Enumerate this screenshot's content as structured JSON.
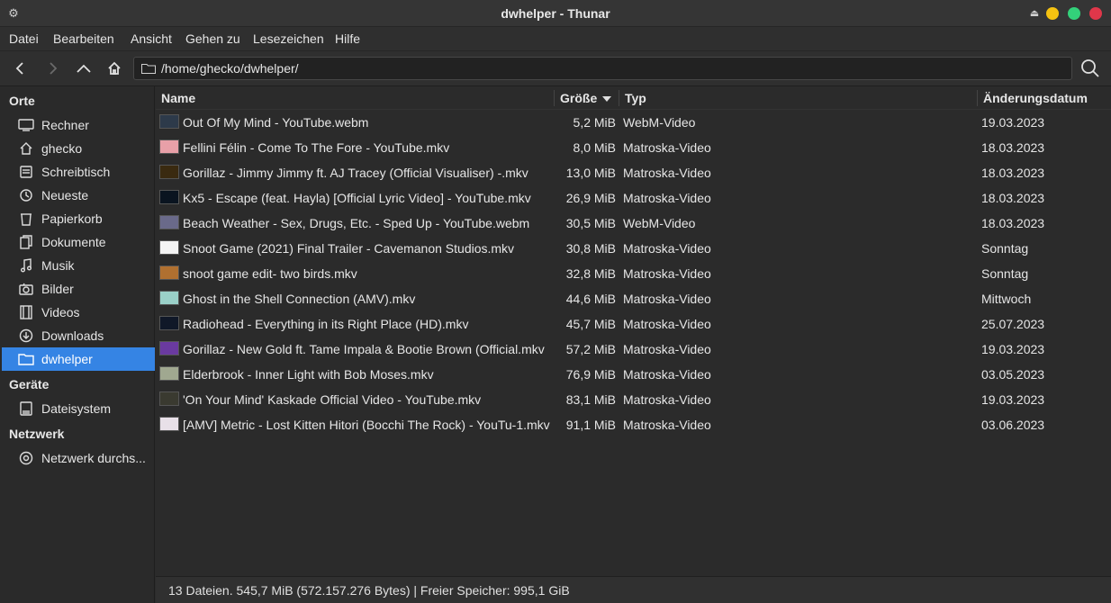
{
  "window": {
    "title": "dwhelper - Thunar"
  },
  "menubar": {
    "items": [
      {
        "label": "Datei"
      },
      {
        "label": "Bearbeiten"
      },
      {
        "label": "Ansicht"
      },
      {
        "label": "Gehen zu"
      },
      {
        "label": "Lesezeichen"
      },
      {
        "label": "Hilfe"
      }
    ]
  },
  "toolbar": {
    "location": "/home/ghecko/dwhelper/"
  },
  "sidebar": {
    "headings": {
      "places": "Orte",
      "devices": "Geräte",
      "network": "Netzwerk"
    },
    "places": [
      {
        "label": "Rechner",
        "icon": "computer-icon"
      },
      {
        "label": "ghecko",
        "icon": "home-icon"
      },
      {
        "label": "Schreibtisch",
        "icon": "desktop-icon"
      },
      {
        "label": "Neueste",
        "icon": "recent-icon"
      },
      {
        "label": "Papierkorb",
        "icon": "trash-icon"
      },
      {
        "label": "Dokumente",
        "icon": "documents-icon"
      },
      {
        "label": "Musik",
        "icon": "music-icon"
      },
      {
        "label": "Bilder",
        "icon": "camera-icon"
      },
      {
        "label": "Videos",
        "icon": "film-icon"
      },
      {
        "label": "Downloads",
        "icon": "download-icon"
      },
      {
        "label": "dwhelper",
        "icon": "folder-icon",
        "active": true
      }
    ],
    "devices": [
      {
        "label": "Dateisystem",
        "icon": "drive-icon"
      }
    ],
    "network": [
      {
        "label": "Netzwerk durchs...",
        "icon": "network-icon"
      }
    ]
  },
  "filelist": {
    "columns": {
      "name": "Name",
      "size": "Größe",
      "type": "Typ",
      "date": "Änderungsdatum"
    },
    "sort": {
      "column": "size",
      "direction": "descending-arrow"
    },
    "files": [
      {
        "name": "Out Of My Mind - YouTube.webm",
        "size": "5,2 MiB",
        "type": "WebM-Video",
        "date": "19.03.2023",
        "thumb": "#2d3a4a"
      },
      {
        "name": "Fellini Félin - Come To The Fore - YouTube.mkv",
        "size": "8,0 MiB",
        "type": "Matroska-Video",
        "date": "18.03.2023",
        "thumb": "#e8a0a8"
      },
      {
        "name": "Gorillaz - Jimmy Jimmy ft. AJ Tracey (Official Visualiser) -.mkv",
        "size": "13,0 MiB",
        "type": "Matroska-Video",
        "date": "18.03.2023",
        "thumb": "#3a2a10"
      },
      {
        "name": "Kx5 - Escape (feat. Hayla) [Official Lyric Video] - YouTube.mkv",
        "size": "26,9 MiB",
        "type": "Matroska-Video",
        "date": "18.03.2023",
        "thumb": "#0a1420"
      },
      {
        "name": "Beach Weather - Sex, Drugs, Etc. - Sped Up - YouTube.webm",
        "size": "30,5 MiB",
        "type": "WebM-Video",
        "date": "18.03.2023",
        "thumb": "#6a6a8a"
      },
      {
        "name": "Snoot Game (2021) Final Trailer - Cavemanon Studios.mkv",
        "size": "30,8 MiB",
        "type": "Matroska-Video",
        "date": "Sonntag",
        "thumb": "#f4f4f4"
      },
      {
        "name": "snoot game edit- two birds.mkv",
        "size": "32,8 MiB",
        "type": "Matroska-Video",
        "date": "Sonntag",
        "thumb": "#b07030"
      },
      {
        "name": "Ghost in the Shell Connection (AMV).mkv",
        "size": "44,6 MiB",
        "type": "Matroska-Video",
        "date": "Mittwoch",
        "thumb": "#9ad0c8"
      },
      {
        "name": "Radiohead - Everything in its Right Place (HD).mkv",
        "size": "45,7 MiB",
        "type": "Matroska-Video",
        "date": "25.07.2023",
        "thumb": "#101828"
      },
      {
        "name": "Gorillaz - New Gold ft. Tame Impala & Bootie Brown (Official.mkv",
        "size": "57,2 MiB",
        "type": "Matroska-Video",
        "date": "19.03.2023",
        "thumb": "#6a3aa0"
      },
      {
        "name": "Elderbrook - Inner Light with Bob Moses.mkv",
        "size": "76,9 MiB",
        "type": "Matroska-Video",
        "date": "03.05.2023",
        "thumb": "#a0a890"
      },
      {
        "name": "'On Your Mind' Kaskade Official Video - YouTube.mkv",
        "size": "83,1 MiB",
        "type": "Matroska-Video",
        "date": "19.03.2023",
        "thumb": "#3a3a30"
      },
      {
        "name": "[AMV] Metric - Lost Kitten Hitori (Bocchi The Rock) - YouTu-1.mkv",
        "size": "91,1 MiB",
        "type": "Matroska-Video",
        "date": "03.06.2023",
        "thumb": "#e8e0e8"
      }
    ]
  },
  "statusbar": {
    "text": "13 Dateien. 545,7 MiB (572.157.276 Bytes)  |  Freier Speicher: 995,1 GiB"
  },
  "colors": {
    "accent": "#3584e4",
    "window_bg": "#2b2b2b"
  }
}
